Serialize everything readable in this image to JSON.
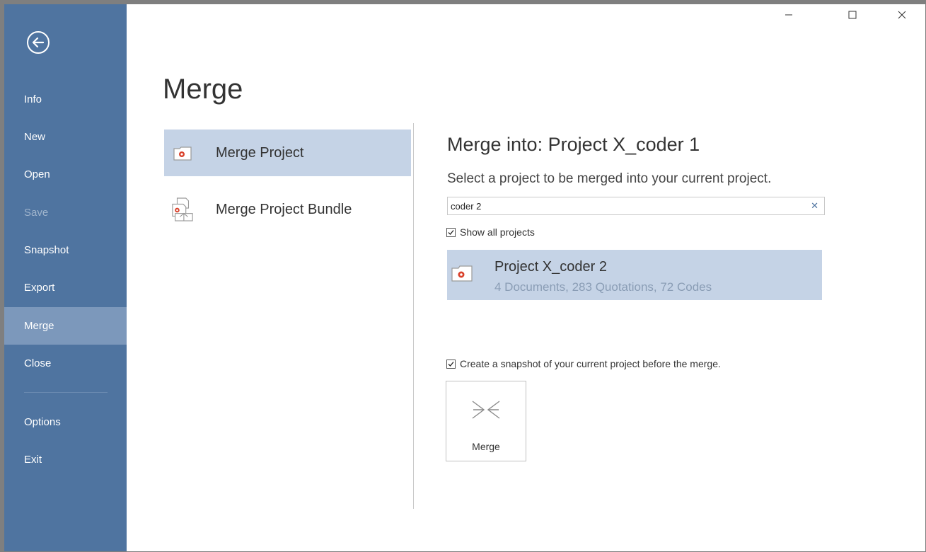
{
  "window_controls": {
    "minimize": "—",
    "maximize": "☐",
    "close": "✕"
  },
  "sidebar": {
    "items": [
      {
        "label": "Info"
      },
      {
        "label": "New"
      },
      {
        "label": "Open"
      },
      {
        "label": "Save"
      },
      {
        "label": "Snapshot"
      },
      {
        "label": "Export"
      },
      {
        "label": "Merge"
      },
      {
        "label": "Close"
      },
      {
        "label": "Options"
      },
      {
        "label": "Exit"
      }
    ],
    "active": "Merge",
    "disabled": [
      "Save"
    ]
  },
  "main": {
    "title": "Merge",
    "options": [
      {
        "label": "Merge Project",
        "icon": "project-icon",
        "selected": true
      },
      {
        "label": "Merge Project Bundle",
        "icon": "project-bundle-icon",
        "selected": false
      }
    ]
  },
  "detail": {
    "title": "Merge into: Project X_coder 1",
    "subtitle": "Select a project to be merged into your current project.",
    "search": {
      "value": "coder 2",
      "clear_label": "✕"
    },
    "show_all": {
      "label": "Show all projects",
      "checked": true
    },
    "projects": [
      {
        "name": "Project X_coder 2",
        "meta": "4 Documents, 283 Quotations, 72 Codes"
      }
    ],
    "snapshot": {
      "label": "Create a snapshot of your current project before the merge.",
      "checked": true
    },
    "merge_button": {
      "label": "Merge"
    }
  },
  "colors": {
    "sidebar": "#4f74a0",
    "sidebar_active": "#7c98bb",
    "selection": "#c5d3e6",
    "accent": "#d9402a"
  }
}
